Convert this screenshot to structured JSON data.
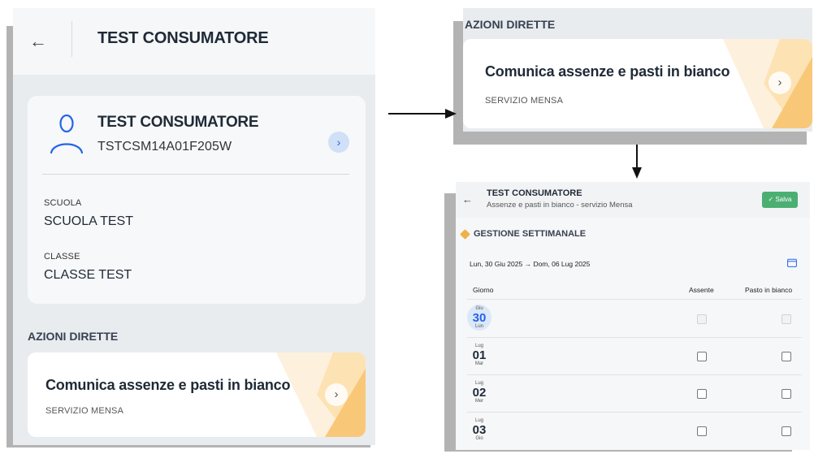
{
  "left": {
    "header_title": "TEST CONSUMATORE",
    "back_icon": "←",
    "user": {
      "name": "TEST CONSUMATORE",
      "code": "TSTCSM14A01F205W",
      "expand_icon": "›"
    },
    "school": {
      "label": "SCUOLA",
      "value": "SCUOLA TEST"
    },
    "class": {
      "label": "CLASSE",
      "value": "CLASSE TEST"
    },
    "section_title": "AZIONI DIRETTE",
    "action": {
      "title": "Comunica assenze e pasti in bianco",
      "subtitle": "SERVIZIO MENSA",
      "chevron": "›"
    }
  },
  "top_right": {
    "section_title": "AZIONI DIRETTE",
    "action": {
      "title": "Comunica assenze e pasti in bianco",
      "subtitle": "SERVIZIO MENSA",
      "chevron": "›"
    }
  },
  "bottom_right": {
    "back_icon": "←",
    "title": "TEST CONSUMATORE",
    "subtitle": "Assenze e pasti in bianco - servizio Mensa",
    "save_label": "✓ Salva",
    "week_title": "GESTIONE SETTIMANALE",
    "range": "Lun, 30 Giu 2025  →  Dom, 06 Lug 2025",
    "columns": {
      "day": "Giorno",
      "absent": "Assente",
      "plain_meal": "Pasto in bianco"
    },
    "rows": [
      {
        "month": "Giu",
        "day": "30",
        "weekday": "Lun",
        "today": true,
        "disabled": true
      },
      {
        "month": "Lug",
        "day": "01",
        "weekday": "Mar",
        "today": false,
        "disabled": false
      },
      {
        "month": "Lug",
        "day": "02",
        "weekday": "Mer",
        "today": false,
        "disabled": false
      },
      {
        "month": "Lug",
        "day": "03",
        "weekday": "Gio",
        "today": false,
        "disabled": false
      }
    ]
  },
  "colors": {
    "accent_blue": "#2563eb",
    "save_green": "#4caf72",
    "deco_orange": "#f7c97a",
    "deco_light": "#fde9c8"
  }
}
